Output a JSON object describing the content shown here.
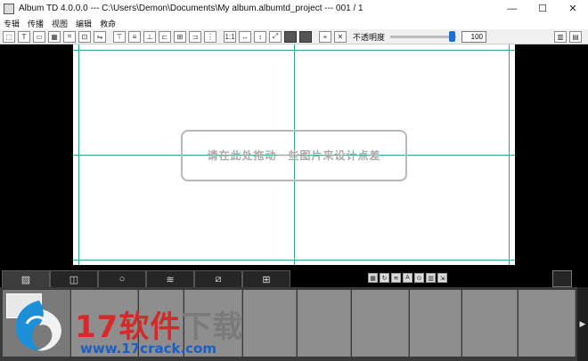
{
  "window": {
    "title": "Album TD 4.0.0.0 --- C:\\Users\\Demon\\Documents\\My album.albumtd_project --- 001 / 1",
    "minimize_glyph": "—",
    "maximize_glyph": "☐",
    "close_glyph": "✕"
  },
  "menu": {
    "items": [
      "专辑",
      "传播",
      "视图",
      "编辑",
      "救命"
    ]
  },
  "toolbar": {
    "buttons": [
      "select-frame",
      "text-frame",
      "image-frame",
      "grid-frame",
      "crop",
      "fit",
      "flip",
      "align-top",
      "align-middle",
      "align-bottom",
      "align-left",
      "align-center",
      "align-right",
      "distribute",
      "one-to-one",
      "fit-width",
      "fit-height",
      "resize",
      "bring-front",
      "send-back",
      "add",
      "remove"
    ],
    "one_to_one_label": "1:1",
    "opacity_label": "不透明度",
    "opacity_value": "100",
    "opacity_fraction": 1.0
  },
  "canvas": {
    "drop_hint": "请在此处拖动一些图片来设计点差",
    "guide_color": "#2ea88e"
  },
  "bottom_panel": {
    "tabs": [
      "photos",
      "frames",
      "shapes",
      "patterns",
      "clipart",
      "layouts"
    ],
    "active_tab": "photos",
    "strip_tools": [
      "grid",
      "rotate",
      "shuffle",
      "text",
      "link",
      "delete",
      "export"
    ]
  },
  "watermark": {
    "brand_number": "17",
    "brand_red": "软件",
    "brand_gray": "下载",
    "url": "www.17crack.com"
  }
}
